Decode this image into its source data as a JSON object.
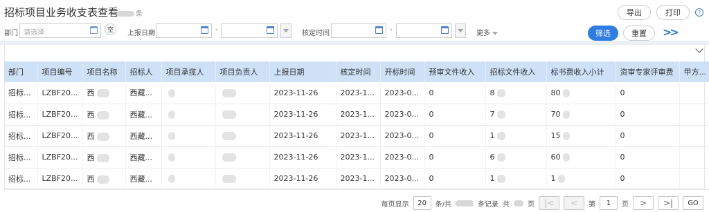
{
  "title": "招标项目业务收支表查看",
  "title_count_suffix": "条",
  "toolbar": {
    "export_label": "导出",
    "print_label": "打印",
    "help_icon": "question-circle-icon"
  },
  "filters": {
    "dept_label": "部门",
    "dept_placeholder": "请选择",
    "empty_label": "空",
    "report_date_label": "上报日期",
    "approve_time_label": "核定时间",
    "range_sep": "-",
    "more_label": "更多",
    "filter_btn": "筛选",
    "reset_btn": "重置"
  },
  "colors": {
    "accent": "#2e7de1",
    "header_bg": "#cfe1f7"
  },
  "table": {
    "headers": [
      "部门",
      "项目编号",
      "项目名称",
      "招标人",
      "项目承揽人",
      "项目负责人",
      "上报日期",
      "核定时间",
      "开标时间",
      "预审文件收入",
      "招标文件收入",
      "标书费收入小计",
      "资审专家评审费",
      "甲方..."
    ],
    "rows": [
      [
        "招标...",
        "LZBF20...",
        "西",
        "西藏...",
        "",
        "",
        "2023-11-26",
        "2023-1...",
        "2023-0...",
        "0",
        "8",
        "80",
        "0",
        ""
      ],
      [
        "招标...",
        "LZBF20...",
        "西",
        "西藏...",
        "",
        "",
        "2023-11-26",
        "2023-1...",
        "2023-0...",
        "0",
        "7",
        "70",
        "0",
        ""
      ],
      [
        "招标...",
        "LZBF20...",
        "西",
        "西藏...",
        "",
        "",
        "2023-11-26",
        "2023-1...",
        "2023-0...",
        "0",
        "1",
        "15",
        "0",
        ""
      ],
      [
        "招标...",
        "LZBF20...",
        "西",
        "西藏...",
        "",
        "",
        "2023-11-26",
        "2023-1...",
        "2023-0...",
        "0",
        "6",
        "60",
        "0",
        ""
      ],
      [
        "招标...",
        "LZBF20...",
        "西",
        "西藏...",
        "",
        "",
        "2023-11-26",
        "2023-1...",
        "2023-0...",
        "0",
        "1",
        "1",
        "0",
        ""
      ]
    ]
  },
  "pagination": {
    "per_page_label": "每页显示",
    "per_page_value": "20",
    "records_prefix": "条/共",
    "records_suffix": "条记录",
    "total_pages_prefix": "共",
    "total_pages_suffix": "页",
    "page_label_prefix": "第",
    "current_page": "1",
    "page_label_suffix": "页",
    "go_label": "GO"
  }
}
